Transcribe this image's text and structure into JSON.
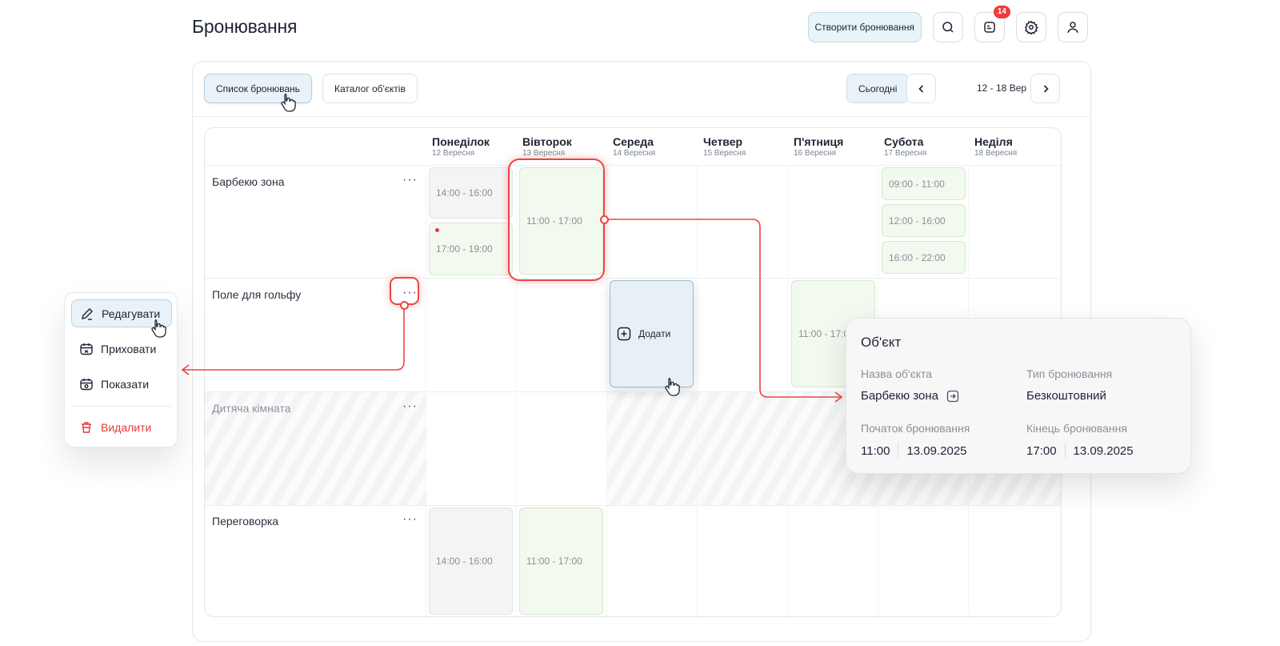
{
  "header": {
    "title": "Бронювання",
    "create_label": "Створити бронювання",
    "notifications_count": "14"
  },
  "toolbar": {
    "tabs": [
      {
        "label": "Список бронювань",
        "active": true
      },
      {
        "label": "Каталог об'єктів",
        "active": false
      }
    ],
    "today_label": "Сьогодні",
    "range": "12 - 18 Вер"
  },
  "days": [
    {
      "name": "Понеділок",
      "date": "12 Вересня"
    },
    {
      "name": "Вівторок",
      "date": "13 Вересня"
    },
    {
      "name": "Середа",
      "date": "14 Вересня"
    },
    {
      "name": "Четвер",
      "date": "15 Вересня"
    },
    {
      "name": "П'ятниця",
      "date": "16 Вересня"
    },
    {
      "name": "Субота",
      "date": "17 Вересня"
    },
    {
      "name": "Неділя",
      "date": "18 Вересня"
    }
  ],
  "rows": [
    {
      "name": "Барбекю зона"
    },
    {
      "name": "Поле для гольфу"
    },
    {
      "name": "Дитяча кімната"
    },
    {
      "name": "Переговорка"
    }
  ],
  "slots": {
    "bbq_mon_1": "14:00 - 16:00",
    "bbq_mon_2": "17:00 - 19:00",
    "bbq_tue": "11:00 - 17:00",
    "bbq_sat_1": "09:00 - 11:00",
    "bbq_sat_2": "12:00 - 16:00",
    "bbq_sat_3": "16:00 - 22:00",
    "golf_wed_add": "Додати",
    "golf_fri": "11:00 - 17:00",
    "meet_mon": "14:00 - 16:00",
    "meet_tue": "11:00 - 17:00"
  },
  "context_menu": {
    "edit": "Редагувати",
    "hide": "Приховати",
    "show": "Показати",
    "delete": "Видалити"
  },
  "popup": {
    "title": "Об'єкт",
    "object_name_label": "Назва об'єкта",
    "object_name": "Барбекю зона",
    "type_label": "Тип бронювання",
    "type_value": "Безкоштовний",
    "start_label": "Початок бронювання",
    "start_time": "11:00",
    "start_date": "13.09.2025",
    "end_label": "Кінець бронювання",
    "end_time": "17:00",
    "end_date": "13.09.2025"
  },
  "colors": {
    "accent_red": "#ef4444",
    "slot_green": "#f2f9ee",
    "slot_grey": "#f4f4f5",
    "active_blue": "#e8f2f8"
  }
}
